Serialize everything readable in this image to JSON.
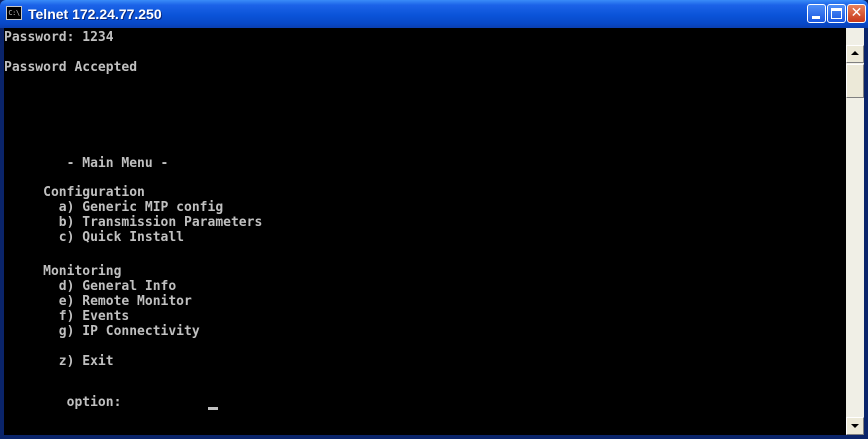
{
  "window": {
    "title": "Telnet 172.24.77.250",
    "system_icon": "console-icon",
    "system_icon_text": "C:\\"
  },
  "console": {
    "lines": [
      "Password: 1234",
      "",
      "Password Accepted",
      "",
      "",
      "",
      "",
      "        - Main Menu -",
      "",
      "     Configuration",
      "       a) Generic MIP config",
      "       b) Transmission Parameters",
      "       c) Quick Install",
      "",
      "     Monitoring",
      "       d) General Info",
      "       e) Remote Monitor",
      "       f) Events",
      "       g) IP Connectivity",
      "",
      "       z) Exit",
      "",
      "        option: "
    ]
  },
  "colors": {
    "console_background": "#000000",
    "console_text": "#c0c0c0",
    "titlebar": "#0a53d8"
  }
}
